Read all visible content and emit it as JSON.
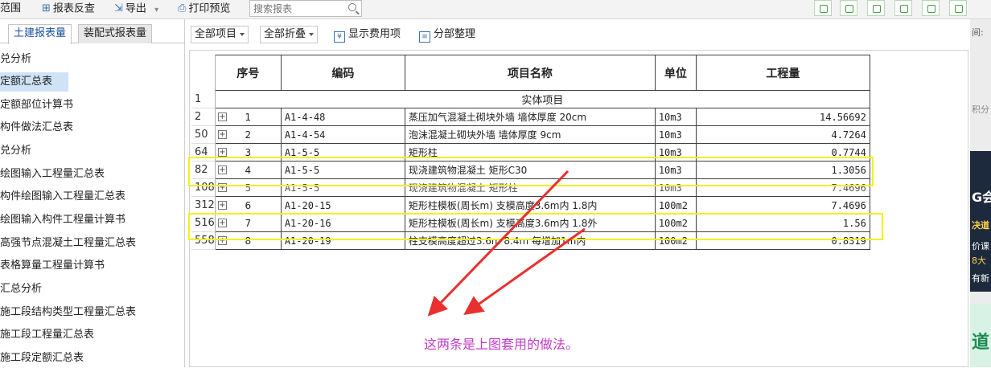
{
  "toolbar": {
    "scope_label": "范围",
    "reverse_label": "报表反查",
    "export_label": "导出",
    "print_label": "打印预览",
    "search_placeholder": "搜索报表"
  },
  "left_panel": {
    "tabs": [
      {
        "label": "土建报表量"
      },
      {
        "label": "装配式报表量"
      }
    ],
    "items": [
      {
        "label": "兑分析"
      },
      {
        "label": "定额汇总表"
      },
      {
        "label": "定额部位计算书"
      },
      {
        "label": "构件做法汇总表"
      },
      {
        "label": "兑分析"
      },
      {
        "label": "绘图输入工程量汇总表"
      },
      {
        "label": "构件绘图输入工程量汇总表"
      },
      {
        "label": "绘图输入构件工程量计算书"
      },
      {
        "label": "高强节点混凝土工程量汇总表"
      },
      {
        "label": "表格算量工程量计算书"
      },
      {
        "label": "汇总分析"
      },
      {
        "label": "施工段结构类型工程量汇总表"
      },
      {
        "label": "施工段工程量汇总表"
      },
      {
        "label": "施工段定额汇总表"
      }
    ]
  },
  "filter_bar": {
    "project_select": "全部项目",
    "fold_select": "全部折叠",
    "show_fee_label": "显示费用项",
    "organize_label": "分部整理"
  },
  "table": {
    "headers": {
      "seq": "序号",
      "code": "编码",
      "name": "项目名称",
      "unit": "单位",
      "qty": "工程量"
    },
    "group_row": {
      "row_no": "1",
      "label": "实体项目"
    },
    "rows": [
      {
        "row_no": "2",
        "seq": "1",
        "code": "A1-4-48",
        "name": "蒸压加气混凝土砌块外墙 墙体厚度 20cm",
        "unit": "10m3",
        "qty": "14.56692"
      },
      {
        "row_no": "50",
        "seq": "2",
        "code": "A1-4-54",
        "name": "泡沫混凝土砌块外墙 墙体厚度 9cm",
        "unit": "10m3",
        "qty": "4.7264"
      },
      {
        "row_no": "64",
        "seq": "3",
        "code": "A1-5-5",
        "name": "矩形柱",
        "unit": "10m3",
        "qty": "0.7744"
      },
      {
        "row_no": "82",
        "seq": "4",
        "code": "A1-5-5",
        "name": "现浇建筑物混凝土 矩形C30",
        "unit": "10m3",
        "qty": "1.3056"
      },
      {
        "row_no": "108",
        "seq": "5",
        "code": "A1-5-5",
        "name": "现浇建筑物混凝土 矩形柱",
        "unit": "10m3",
        "qty": "7.4696"
      },
      {
        "row_no": "312",
        "seq": "6",
        "code": "A1-20-15",
        "name": "矩形柱模板(周长m) 支模高度3.6m内 1.8内",
        "unit": "100m2",
        "qty": "7.4696"
      },
      {
        "row_no": "516",
        "seq": "7",
        "code": "A1-20-16",
        "name": "矩形柱模板(周长m) 支模高度3.6m内 1.8外",
        "unit": "100m2",
        "qty": "1.56"
      },
      {
        "row_no": "558",
        "seq": "8",
        "code": "A1-20-19",
        "name": "柱支模高度超过3.6m 8.4m 每增加1m内",
        "unit": "100m2",
        "qty": "0.8319"
      }
    ]
  },
  "annotation": {
    "text": "这两条是上图套用的做法。"
  },
  "right_strip": {
    "time_label": "间:",
    "points_label": "积分",
    "banner_title": "G会",
    "banner_line1": "决道",
    "banner_line2": "价课",
    "banner_line3": "8大",
    "banner_line4": "有新",
    "green_label": "道"
  },
  "colors": {
    "highlight": "#f2f21a",
    "arrow": "#e8312f",
    "annotation": "#c23bc6",
    "tab_active": "#1b4fa0"
  }
}
